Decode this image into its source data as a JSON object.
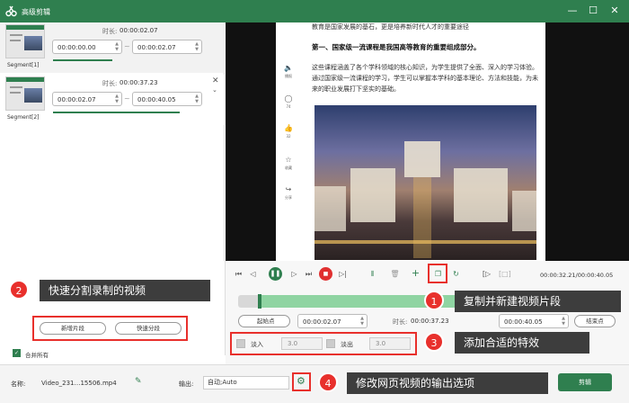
{
  "window": {
    "title": "高级剪辑",
    "minimize_glyph": "—",
    "maximize_glyph": "☐",
    "close_glyph": "✕"
  },
  "segments": [
    {
      "label": "Segment[1]",
      "duration_label": "时长:",
      "duration": "00:00:02.07",
      "start": "00:00:00.00",
      "end": "00:00:02.07",
      "progress": 0.4
    },
    {
      "label": "Segment[2]",
      "duration_label": "时长:",
      "duration": "00:00:37.23",
      "start": "00:00:02.07",
      "end": "00:00:40.05",
      "progress": 0.85
    }
  ],
  "preview": {
    "line0": "教育是国家发展的基石，更是培养新时代人才的重要途径",
    "heading": "第一、国家级一流课程是我国高等教育的重要组成部分。",
    "paragraph1": "这些课程涵盖了各个学科领域的核心知识，为学生提供了全面、深入的学习体验。",
    "paragraph2": "通过国家级一流课程的学习，学生可以掌握本学科的基本理论、方法和技能，为未来的职业发展打下坚实的基础。",
    "sidebar": [
      {
        "icon": "speaker-icon",
        "glyph": "🔈",
        "text": "播报"
      },
      {
        "icon": "comment-icon",
        "glyph": "◯",
        "text": "74"
      },
      {
        "icon": "like-icon",
        "glyph": "👍",
        "text": "32"
      },
      {
        "icon": "star-icon",
        "glyph": "☆",
        "text": "收藏"
      },
      {
        "icon": "share-icon",
        "glyph": "↪",
        "text": "分享"
      }
    ]
  },
  "controls": {
    "time_readout": "00:00:32.21/00:00:40.05",
    "start_label": "起始点",
    "start_time": "00:00:02.07",
    "duration_label": "时长:",
    "duration_time": "00:00:37.23",
    "end_time": "00:00:40.05",
    "end_label": "结束点",
    "fade_in_label": "淡入",
    "fade_in_value": "3.0",
    "fade_out_label": "淡出",
    "fade_out_value": "3.0",
    "trim_start": 0.06
  },
  "left_actions": {
    "new_segment": "新增片段",
    "quick_split": "快速分段"
  },
  "merge_all": {
    "label": "合并所有",
    "checked": true
  },
  "bottom": {
    "name_label": "名称:",
    "file_name": "Video_231…15506.mp4",
    "output_label": "输出:",
    "output_value": "自动;Auto",
    "cut_button": "剪辑"
  },
  "annotations": [
    {
      "num": "1",
      "text": "复制并新建视频片段"
    },
    {
      "num": "2",
      "text": "快速分割录制的视频"
    },
    {
      "num": "3",
      "text": "添加合适的特效"
    },
    {
      "num": "4",
      "text": "修改网页视频的输出选项"
    }
  ],
  "colors": {
    "brand": "#2f7f4f",
    "accent_red": "#e8302c",
    "callout_bg": "#3d3d3d"
  }
}
